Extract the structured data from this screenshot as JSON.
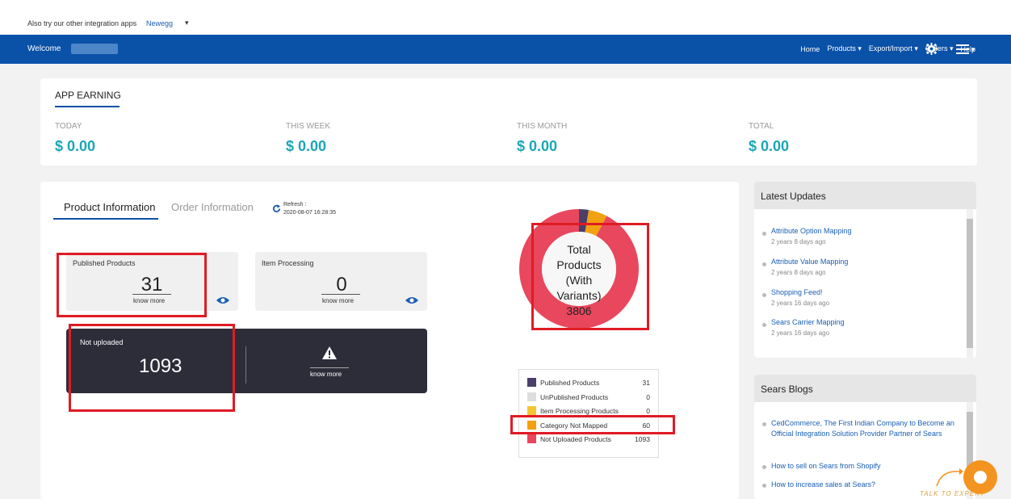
{
  "topbar": {
    "label": "Also try our other integration apps",
    "app_select": "Newegg"
  },
  "navbar": {
    "welcome": "Welcome",
    "menu": [
      {
        "label": "Home",
        "caret": false
      },
      {
        "label": "Products",
        "caret": true
      },
      {
        "label": "Export/Import",
        "caret": true
      },
      {
        "label": "Orders",
        "caret": true
      },
      {
        "label": "Help",
        "caret": false
      }
    ]
  },
  "earnings": {
    "title": "APP EARNING",
    "items": [
      {
        "label": "TODAY",
        "value": "$ 0.00"
      },
      {
        "label": "THIS WEEK",
        "value": "$ 0.00"
      },
      {
        "label": "THIS MONTH",
        "value": "$ 0.00"
      },
      {
        "label": "TOTAL",
        "value": "$ 0.00"
      }
    ]
  },
  "info": {
    "tabs": [
      "Product Information",
      "Order Information"
    ],
    "refresh_label": "Refresh :",
    "refresh_time": "2020-08-07 16:28:35",
    "published": {
      "label": "Published Products",
      "value": "31",
      "link": "know more"
    },
    "processing": {
      "label": "Item Processing",
      "value": "0",
      "link": "know more"
    },
    "not_uploaded": {
      "label": "Not uploaded",
      "value": "1093",
      "link": "know more"
    }
  },
  "chart_data": {
    "type": "pie",
    "center_text": [
      "Total",
      "Products",
      "(With",
      "Variants)",
      "3806"
    ],
    "categories": [
      "Published Products",
      "UnPublished Products",
      "Item Processing Products",
      "Category Not Mapped",
      "Not Uploaded Products"
    ],
    "values": [
      31,
      0,
      0,
      60,
      1093
    ],
    "colors": [
      "#4a3f6b",
      "#dddddd",
      "#f7c531",
      "#f2a20f",
      "#e8475d"
    ]
  },
  "latest_updates": {
    "title": "Latest Updates",
    "items": [
      {
        "title": "Attribute Option Mapping",
        "ago": "2 years 8 days ago"
      },
      {
        "title": "Attribute Value Mapping",
        "ago": "2 years 8 days ago"
      },
      {
        "title": "Shopping Feed!",
        "ago": "2 years 16 days ago"
      },
      {
        "title": "Sears Carrier Mapping",
        "ago": "2 years 16 days ago"
      }
    ]
  },
  "blogs": {
    "title": "Sears Blogs",
    "items": [
      "CedCommerce, The First Indian Company to Become an Official Integration Solution Provider Partner of Sears",
      "How to sell on Sears from Shopify",
      "How to increase sales at Sears?"
    ]
  },
  "chat": {
    "label": "TALK TO EXPERT"
  }
}
